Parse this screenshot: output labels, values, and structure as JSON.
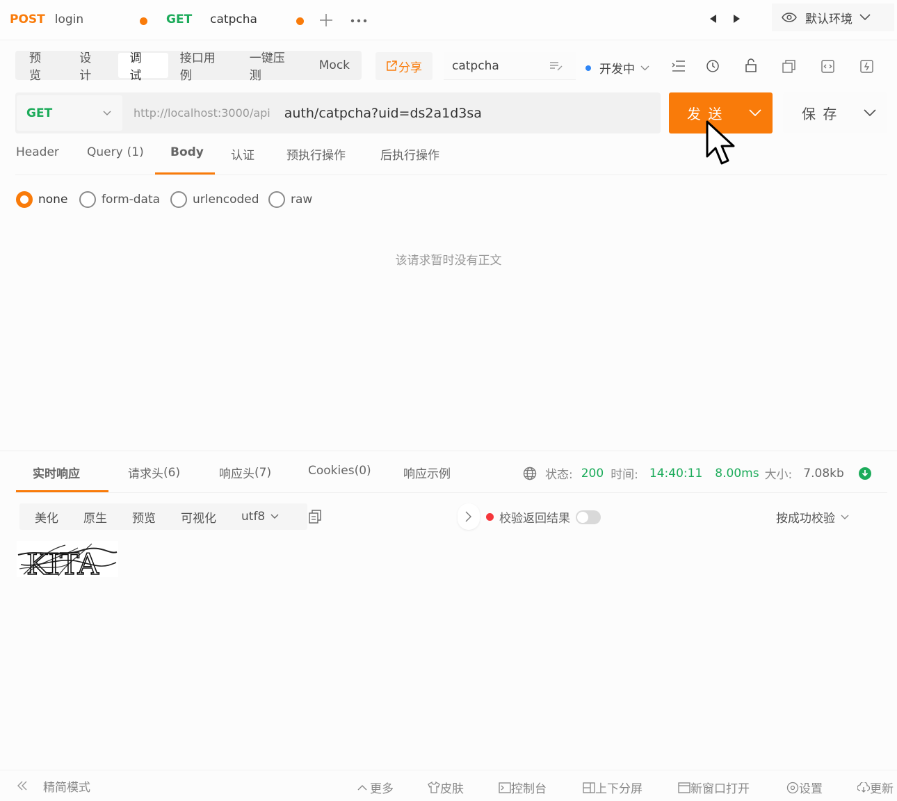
{
  "tabs": [
    {
      "method": "POST",
      "name": "login"
    },
    {
      "method": "GET",
      "name": "catpcha"
    }
  ],
  "env": {
    "label": "默认环境"
  },
  "subnav": {
    "items": [
      "预 览",
      "设 计",
      "调 试",
      "接口用例",
      "一键压测",
      "Mock"
    ],
    "active_index": 2,
    "share_label": "分享",
    "api_name": "catpcha",
    "status_label": "开发中"
  },
  "request": {
    "method": "GET",
    "base_url": "http://localhost:3000/api",
    "path": "auth/catpcha?uid=ds2a1d3sa",
    "send_label": "发 送",
    "save_label": "保 存"
  },
  "request_tabs": [
    {
      "label": "Header",
      "count": ""
    },
    {
      "label": "Query",
      "count": "(1)"
    },
    {
      "label": "Body",
      "count": ""
    },
    {
      "label": "认证",
      "count": ""
    },
    {
      "label": "预执行操作",
      "count": ""
    },
    {
      "label": "后执行操作",
      "count": ""
    }
  ],
  "request_tabs_active": 2,
  "body_types": [
    "none",
    "form-data",
    "urlencoded",
    "raw"
  ],
  "body_selected": "none",
  "body_empty_text": "该请求暂时没有正文",
  "response": {
    "tabs": [
      {
        "label": "实时响应",
        "count": ""
      },
      {
        "label": "请求头",
        "count": "(6)"
      },
      {
        "label": "响应头",
        "count": "(7)"
      },
      {
        "label": "Cookies",
        "count": "(0)"
      },
      {
        "label": "响应示例",
        "count": ""
      }
    ],
    "status_label": "状态:",
    "status_value": "200",
    "time_label": "时间:",
    "time_value": "14:40:11",
    "duration": "8.00ms",
    "size_label": "大小:",
    "size_value": "7.08kb",
    "view_modes": [
      "美化",
      "原生",
      "预览",
      "可视化"
    ],
    "encoding": "utf8",
    "validate_label": "校验返回结果",
    "validate_mode": "按成功校验",
    "captcha_text": "KITA"
  },
  "footer": {
    "left_label": "精简模式",
    "items": [
      "更多",
      "皮肤",
      "控制台",
      "上下分屏",
      "新窗口打开",
      "设置",
      "更新"
    ]
  },
  "colors": {
    "accent": "#f97b0a",
    "get": "#1cab5a",
    "status": "#1cab5a"
  }
}
